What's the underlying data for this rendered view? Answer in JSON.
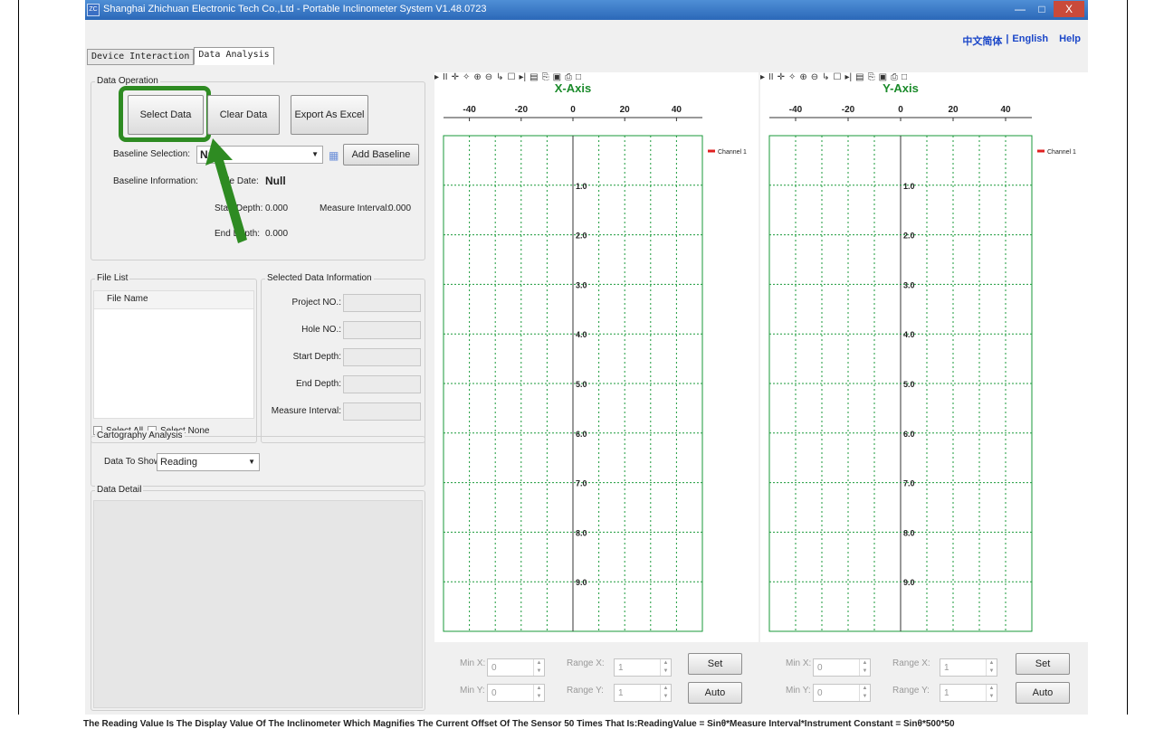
{
  "window": {
    "title": "Shanghai Zhichuan Electronic Tech Co.,Ltd - Portable Inclinometer System V1.48.0723",
    "app_icon": "ZC"
  },
  "lang": {
    "chinese": "中文简体",
    "sep": "|",
    "english": "English",
    "help": "Help"
  },
  "tabs": [
    {
      "label": "Device Interaction"
    },
    {
      "label": "Data Analysis"
    }
  ],
  "data_operation": {
    "title": "Data Operation",
    "select_data": "Select Data",
    "clear_data": "Clear Data",
    "export_excel": "Export As Excel",
    "baseline_selection_label": "Baseline Selection:",
    "baseline_value": "Null",
    "add_baseline": "Add Baseline",
    "baseline_info_label": "Baseline Information:",
    "file_date_label": "File Date:",
    "file_date_value": "Null",
    "start_depth_label": "Start Depth:",
    "start_depth_value": "0.000",
    "measure_interval_label": "Measure Interval:",
    "measure_interval_value": "0.000",
    "end_depth_label": "End Depth:",
    "end_depth_value": "0.000"
  },
  "file_list": {
    "title": "File List",
    "column": "File Name",
    "select_all": "Select All",
    "select_none": "Select None"
  },
  "selected_info": {
    "title": "Selected Data Information",
    "fields": [
      "Project NO.:",
      "Hole NO.:",
      "Start Depth:",
      "End Depth:",
      "Measure Interval:"
    ]
  },
  "cartography": {
    "title": "Cartography Analysis",
    "data_to_show_label": "Data To Show:",
    "data_to_show_value": "Reading"
  },
  "data_detail": {
    "title": "Data Detail"
  },
  "chart_data": [
    {
      "type": "line",
      "title": "X-Axis",
      "x_ticks": [
        "-40",
        "-20",
        "0",
        "20",
        "40"
      ],
      "y_ticks": [
        "1.0",
        "2.0",
        "3.0",
        "4.0",
        "5.0",
        "6.0",
        "7.0",
        "8.0",
        "9.0"
      ],
      "xlim": [
        -50,
        50
      ],
      "ylim": [
        0,
        10
      ],
      "legend": "Channel 1",
      "legend_position": "top-right",
      "series": [
        {
          "name": "Channel 1",
          "values": []
        }
      ],
      "grid": true,
      "accent": "#1a9a3a"
    },
    {
      "type": "line",
      "title": "Y-Axis",
      "x_ticks": [
        "-40",
        "-20",
        "0",
        "20",
        "40"
      ],
      "y_ticks": [
        "1.0",
        "2.0",
        "3.0",
        "4.0",
        "5.0",
        "6.0",
        "7.0",
        "8.0",
        "9.0"
      ],
      "xlim": [
        -50,
        50
      ],
      "ylim": [
        0,
        10
      ],
      "legend": "Channel 1",
      "legend_position": "top-right",
      "series": [
        {
          "name": "Channel 1",
          "values": []
        }
      ],
      "grid": true,
      "accent": "#1a9a3a"
    }
  ],
  "chart_controls": {
    "min_x": "Min X:",
    "min_y": "Min Y:",
    "range_x": "Range X:",
    "range_y": "Range Y:",
    "min_value": "0",
    "range_value": "1",
    "set": "Set",
    "auto": "Auto"
  },
  "status_text": "The Reading Value Is The Display Value Of The Inclinometer Which Magnifies The Current Offset Of The Sensor 50 Times That Is:ReadingValue = Sinθ*Measure Interval*Instrument Constant = Sinθ*500*50",
  "colors": {
    "highlight": "#2e8b22",
    "chart_line": "#1a9a3a",
    "legend_swatch": "#e02020"
  },
  "toolbar_icons": [
    "play-icon",
    "pause-icon",
    "crosshair-icon",
    "pan-icon",
    "zoom-in-icon",
    "zoom-out-icon",
    "pointer-icon",
    "select-rect-icon",
    "step-icon",
    "properties-icon",
    "copy-icon",
    "save-icon",
    "print-icon",
    "print-preview-icon"
  ]
}
